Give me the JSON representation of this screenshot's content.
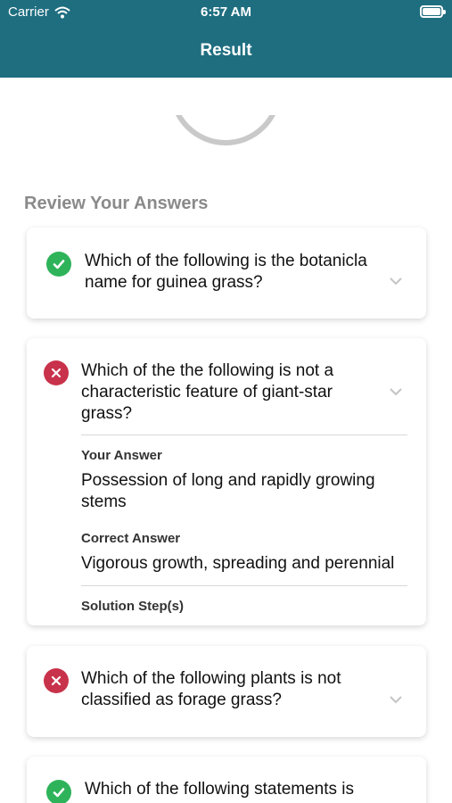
{
  "status_bar": {
    "carrier": "Carrier",
    "time": "6:57 AM"
  },
  "header": {
    "title": "Result"
  },
  "review": {
    "title": "Review Your Answers"
  },
  "questions": [
    {
      "status": "correct",
      "text": "Which of the following is the botanicla name for guinea grass?"
    },
    {
      "status": "wrong",
      "text": "Which of the the following is not a characteristic feature of giant-star grass?",
      "your_answer_label": "Your Answer",
      "your_answer": "Possession of long and rapidly growing stems",
      "correct_answer_label": "Correct Answer",
      "correct_answer": "Vigorous growth, spreading and perennial",
      "solution_label": "Solution Step(s)"
    },
    {
      "status": "wrong",
      "text": "Which of the following plants is not classified as forage grass?"
    },
    {
      "status": "correct",
      "text": "Which of the following statements is"
    }
  ],
  "colors": {
    "header_bg": "#1f6e80",
    "correct": "#2eb35a",
    "wrong": "#c8324a"
  }
}
